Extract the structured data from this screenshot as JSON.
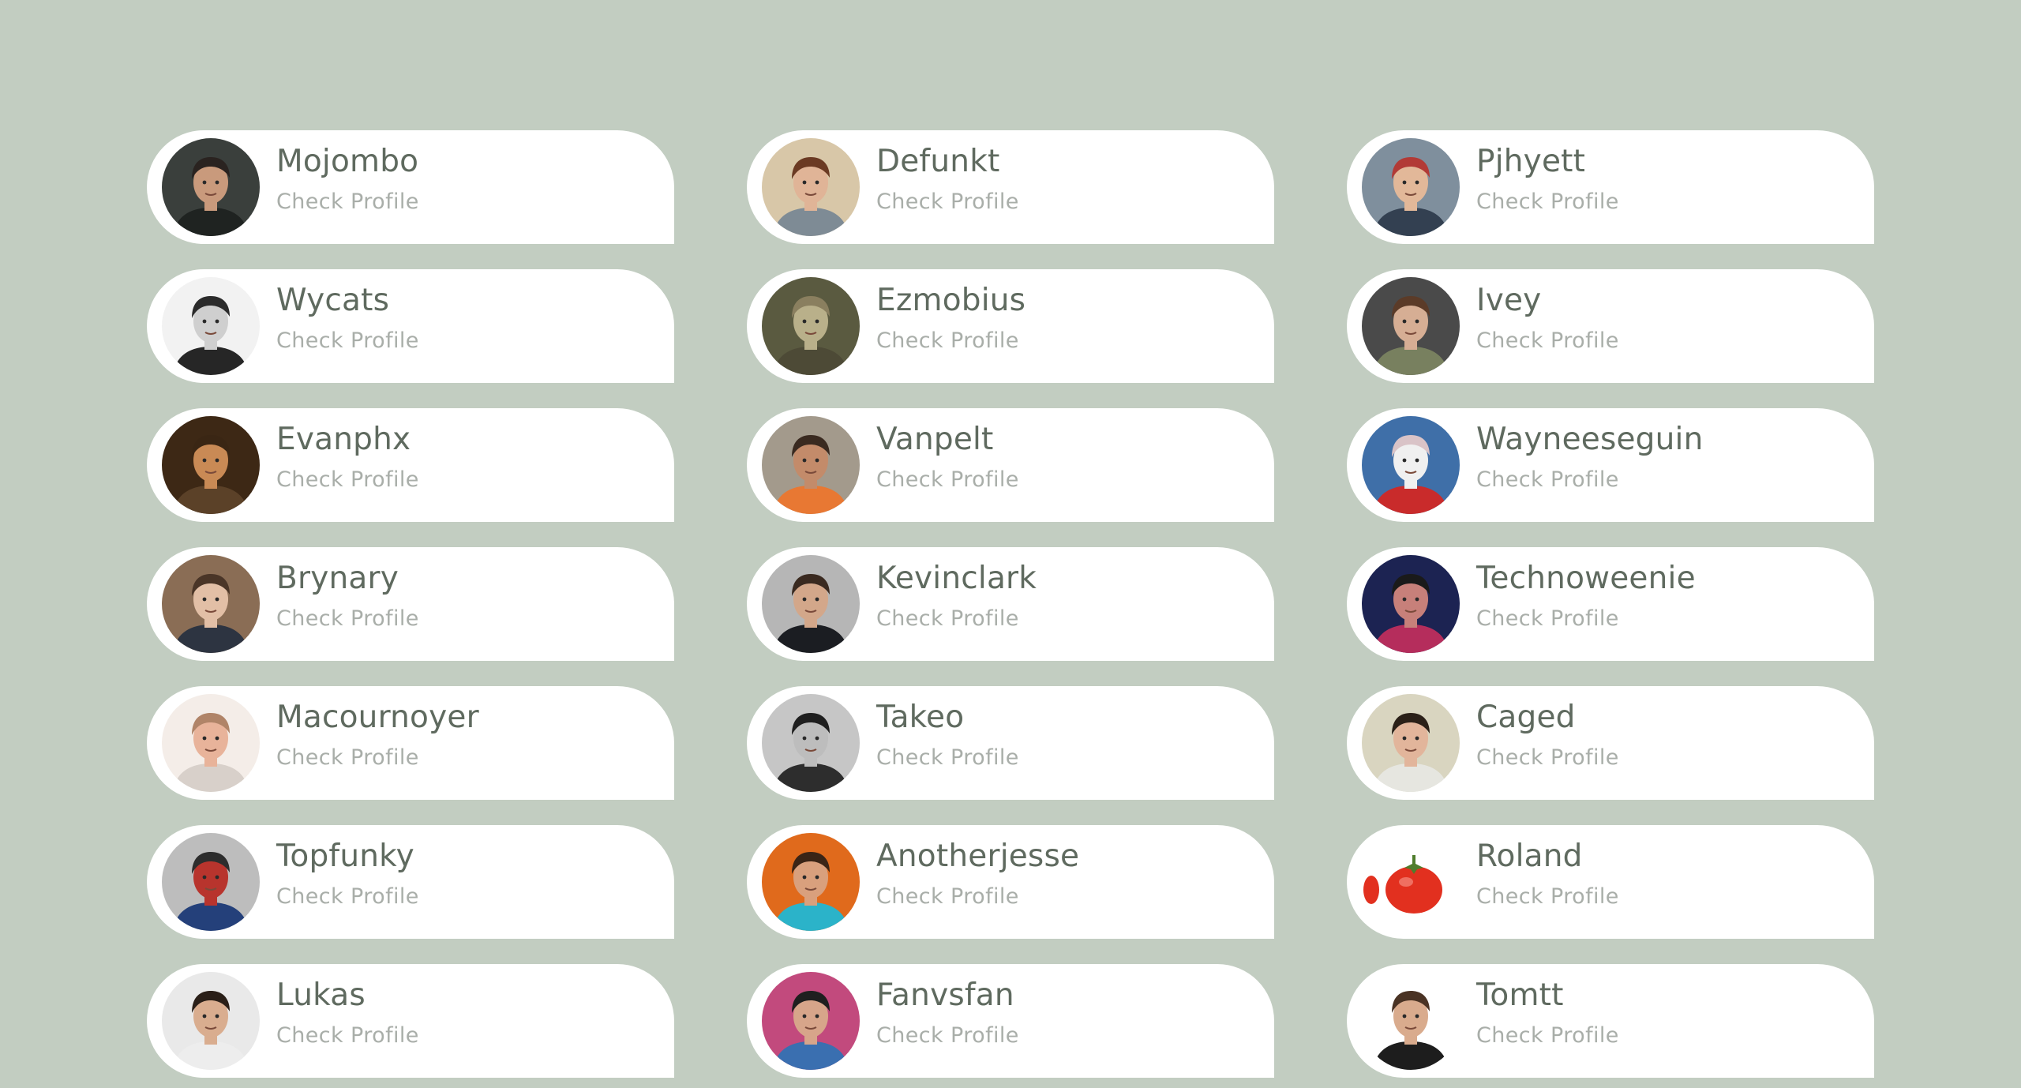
{
  "profiles": [
    {
      "name": "Mojombo",
      "action": "Check Profile",
      "avatar": "portrait-man-dark-background",
      "bg": "#3a3f3c",
      "skin": "#c99a7c",
      "hair": "#2a2320",
      "shirt": "#1f2321"
    },
    {
      "name": "Defunkt",
      "action": "Check Profile",
      "avatar": "portrait-man-sunglasses",
      "bg": "#d8c7a8",
      "skin": "#e0b497",
      "hair": "#6b3a23",
      "shirt": "#7e8b95"
    },
    {
      "name": "Pjhyett",
      "action": "Check Profile",
      "avatar": "portrait-man-cap-glasses",
      "bg": "#7f8f9d",
      "skin": "#e2b899",
      "hair": "#b23a36",
      "shirt": "#334051"
    },
    {
      "name": "Wycats",
      "action": "Check Profile",
      "avatar": "portrait-man-glasses-grayscale",
      "bg": "#f2f2f2",
      "skin": "#cfcfcf",
      "hair": "#2b2b2b",
      "shirt": "#262626"
    },
    {
      "name": "Ezmobius",
      "action": "Check Profile",
      "avatar": "portrait-alien-creature",
      "bg": "#5a5a40",
      "skin": "#b9b08a",
      "hair": "#8a7f5f",
      "shirt": "#4d4a36"
    },
    {
      "name": "Ivey",
      "action": "Check Profile",
      "avatar": "portrait-man-olive-shirt",
      "bg": "#4a4a4a",
      "skin": "#d6ae94",
      "hair": "#5b3b28",
      "shirt": "#78805f"
    },
    {
      "name": "Evanphx",
      "action": "Check Profile",
      "avatar": "portrait-man-warm-light",
      "bg": "#3d2815",
      "skin": "#c98a55",
      "hair": "#3a2614",
      "shirt": "#5b4128"
    },
    {
      "name": "Vanpelt",
      "action": "Check Profile",
      "avatar": "portrait-man-orange-shirt",
      "bg": "#a39a8c",
      "skin": "#c38b6a",
      "hair": "#3a2a20",
      "shirt": "#e87833"
    },
    {
      "name": "Wayneeseguin",
      "action": "Check Profile",
      "avatar": "cartoon-mouse-brain",
      "bg": "#3f6fa8",
      "skin": "#f0f0f0",
      "hair": "#d9c3c7",
      "shirt": "#c92b2b"
    },
    {
      "name": "Brynary",
      "action": "Check Profile",
      "avatar": "portrait-man-glasses-brown",
      "bg": "#8a6d55",
      "skin": "#e2bfa6",
      "hair": "#4a3527",
      "shirt": "#2d3441"
    },
    {
      "name": "Kevinclark",
      "action": "Check Profile",
      "avatar": "portrait-man-dark-jacket",
      "bg": "#b6b6b6",
      "skin": "#d3a78a",
      "hair": "#3a2a20",
      "shirt": "#1b1d22"
    },
    {
      "name": "Technoweenie",
      "action": "Check Profile",
      "avatar": "portrait-man-neon-light",
      "bg": "#1c2352",
      "skin": "#c7807a",
      "hair": "#1a1a1a",
      "shirt": "#b52d5c"
    },
    {
      "name": "Macournoyer",
      "action": "Check Profile",
      "avatar": "portrait-bald-man-beard",
      "bg": "#f4ede8",
      "skin": "#e8b39a",
      "hair": "#b08468",
      "shirt": "#d8d0ca"
    },
    {
      "name": "Takeo",
      "action": "Check Profile",
      "avatar": "portrait-man-beard-grayscale",
      "bg": "#c6c6c6",
      "skin": "#bdbdbd",
      "hair": "#1f1f1f",
      "shirt": "#2d2d2d"
    },
    {
      "name": "Caged",
      "action": "Check Profile",
      "avatar": "portrait-man-long-beard",
      "bg": "#d9d5c0",
      "skin": "#e2b59b",
      "hair": "#2b2018",
      "shirt": "#e6e6e0"
    },
    {
      "name": "Topfunky",
      "action": "Check Profile",
      "avatar": "portrait-flag-face-paint",
      "bg": "#bdbdbd",
      "skin": "#b8342d",
      "hair": "#2d2d2d",
      "shirt": "#24407a"
    },
    {
      "name": "Anotherjesse",
      "action": "Check Profile",
      "avatar": "portrait-man-headphones",
      "bg": "#e06a1c",
      "skin": "#d9a07d",
      "hair": "#3a2416",
      "shirt": "#2bb3c9"
    },
    {
      "name": "Roland",
      "action": "Check Profile",
      "avatar": "tomato",
      "bg": "#ffffff",
      "skin": "#e2301f",
      "hair": "#4f7d2c",
      "shirt": "#e2301f"
    },
    {
      "name": "Lukas",
      "action": "Check Profile",
      "avatar": "portrait-man-curly-hair",
      "bg": "#e9e9e9",
      "skin": "#d9ad8f",
      "hair": "#2a1f18",
      "shirt": "#ededed"
    },
    {
      "name": "Fanvsfan",
      "action": "Check Profile",
      "avatar": "portrait-man-pink-notes",
      "bg": "#c24a7d",
      "skin": "#d7a58a",
      "hair": "#1f1f1f",
      "shirt": "#3a6fb0"
    },
    {
      "name": "Tomtt",
      "action": "Check Profile",
      "avatar": "portrait-man-bearded-white-bg",
      "bg": "#ffffff",
      "skin": "#d9ab8d",
      "hair": "#4a3324",
      "shirt": "#1d1d1d"
    }
  ]
}
